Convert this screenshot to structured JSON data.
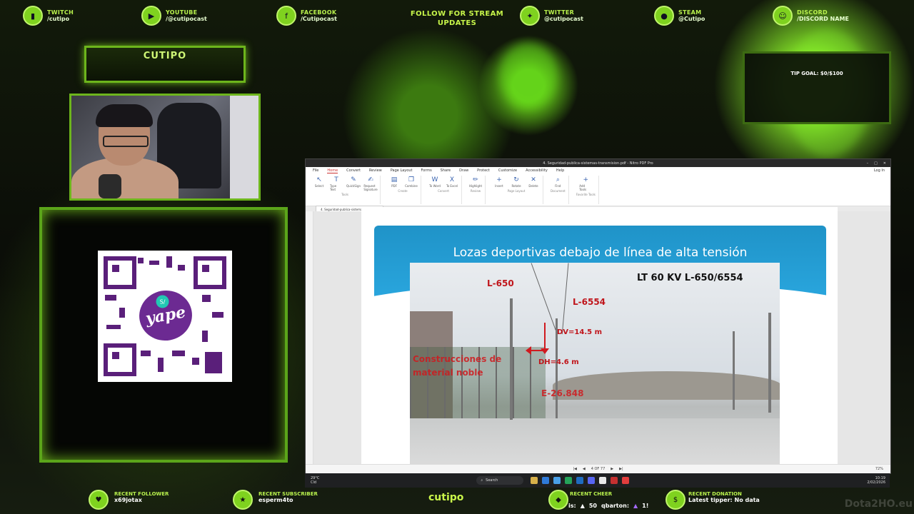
{
  "socials": [
    {
      "label": "TWITCH",
      "value": "/cutipo",
      "icon": "twitch-icon"
    },
    {
      "label": "YOUTUBE",
      "value": "/@cutipocast",
      "icon": "youtube-icon"
    },
    {
      "label": "FACEBOOK",
      "value": "/Cutipocast",
      "icon": "facebook-icon"
    },
    {
      "label": "TWITTER",
      "value": "@cutipocast",
      "icon": "twitter-icon"
    },
    {
      "label": "STEAM",
      "value": "@Cutipo",
      "icon": "steam-icon"
    },
    {
      "label": "DISCORD",
      "value": "/DISCORD NAME",
      "icon": "discord-icon"
    }
  ],
  "follow_text": "FOLLOW FOR STREAM UPDATES",
  "streamer_name": "CUTIPO",
  "tip_goal": "TIP GOAL: $0/$100",
  "qr_brand": "yape",
  "qr_badge": "S/",
  "pdf": {
    "window_title": "4. Seguridad-publica-sistemas-transmision.pdf - Nitro PDF Pro",
    "menu": [
      "File",
      "Home",
      "Convert",
      "Review",
      "Page Layout",
      "Forms",
      "Share",
      "Draw",
      "Protect",
      "Customize",
      "Accessibility",
      "Help"
    ],
    "active_menu": "Home",
    "login": "Log In",
    "ribbon_groups": [
      {
        "label": "Tools",
        "buttons": [
          "Select",
          "Type Text",
          "QuickSign",
          "Request Signature"
        ]
      },
      {
        "label": "Create",
        "buttons": [
          "PDF",
          "Combine"
        ]
      },
      {
        "label": "Convert",
        "buttons": [
          "To Word",
          "To Excel"
        ]
      },
      {
        "label": "Review",
        "buttons": [
          "Highlight"
        ]
      },
      {
        "label": "Page Layout",
        "buttons": [
          "Insert",
          "Rotate",
          "Delete"
        ]
      },
      {
        "label": "Document",
        "buttons": [
          "Find"
        ]
      },
      {
        "label": "Favorite Tools",
        "buttons": [
          "Add Tools"
        ]
      }
    ],
    "doc_tab": "4. Seguridad-publica-sistemas-tra...",
    "slide_title": "Lozas deportivas debajo de línea de alta tensión",
    "labels": {
      "l650": "L-650",
      "l6554": "L-6554",
      "lt": "LT 60 KV L-650/6554",
      "dv": "DV=14.5 m",
      "dh": "DH=4.6 m",
      "const": "Construcciones de material noble",
      "ep": "E-26.848"
    },
    "page_indicator": "4 OF 77",
    "zoom": "72%"
  },
  "taskbar": {
    "weather_temp": "29°C",
    "weather_desc": "Cld",
    "search": "Search",
    "time": "10:19",
    "date": "2/02/2026"
  },
  "bottom": {
    "follower_label": "RECENT FOLLOWER",
    "follower": "x69jotax",
    "subscriber_label": "RECENT SUBSCRIBER",
    "subscriber": "esperm4to",
    "brand": "cutipo",
    "cheer_label": "RECENT CHEER",
    "cheer_a": "is:",
    "cheer_a_amt": "50",
    "cheer_b": "qbarton:",
    "cheer_b_amt": "1!",
    "donation_label": "RECENT DONATION",
    "donation": "Latest tipper: No data",
    "watermark": "Dota2HO.eu"
  }
}
